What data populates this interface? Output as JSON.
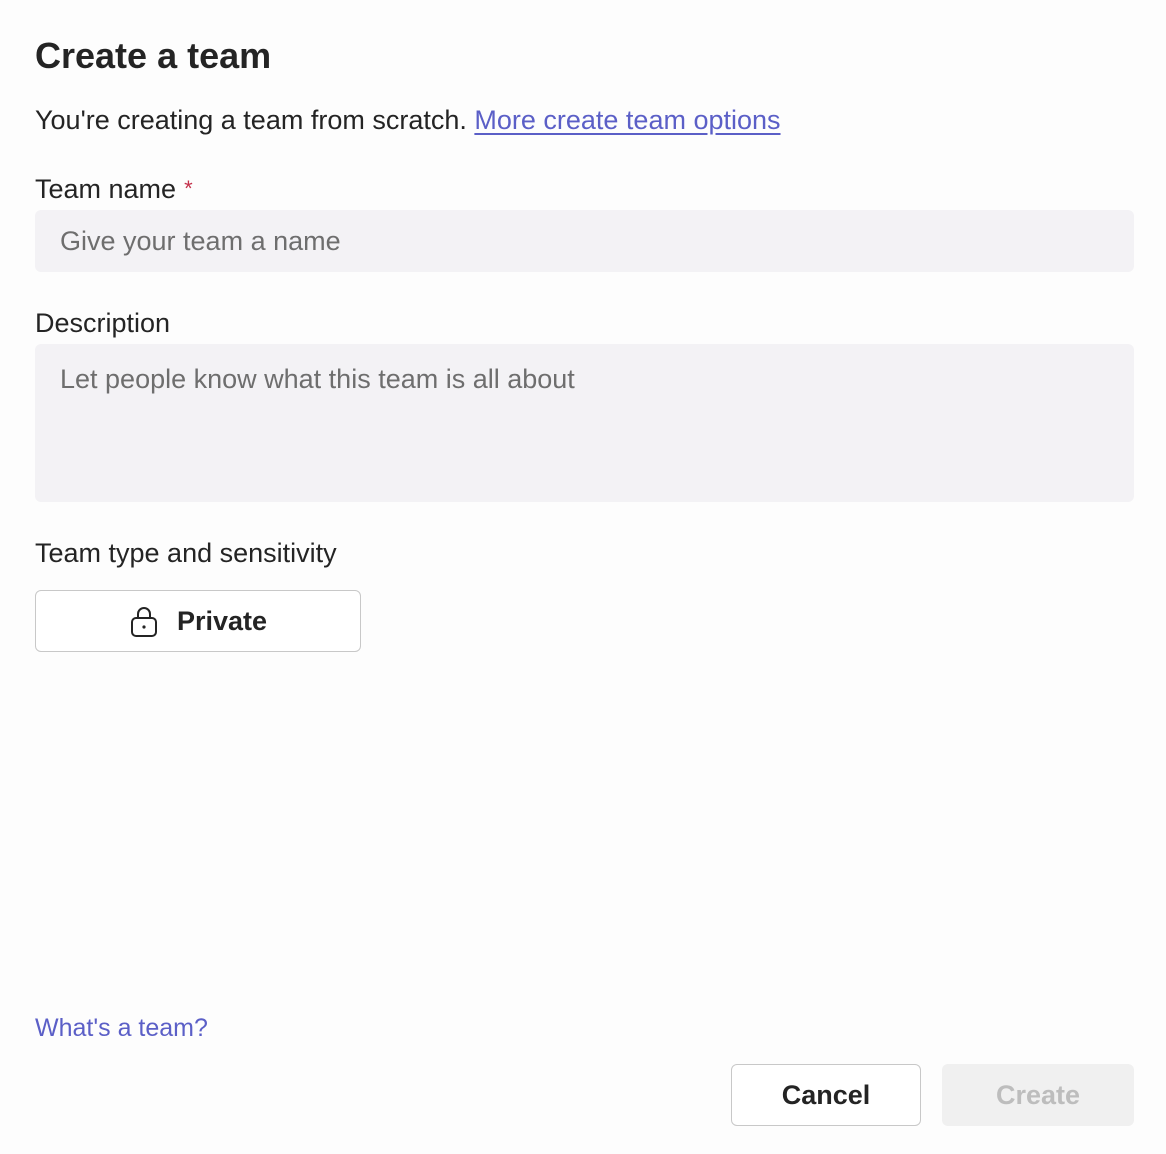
{
  "dialog": {
    "title": "Create a team",
    "subtitle": "You're creating a team from scratch.",
    "more_options_link": "More create team options"
  },
  "team_name": {
    "label": "Team name",
    "required_marker": "*",
    "placeholder": "Give your team a name",
    "value": ""
  },
  "description": {
    "label": "Description",
    "placeholder": "Let people know what this team is all about",
    "value": ""
  },
  "privacy": {
    "label": "Team type and sensitivity",
    "value": "Private",
    "icon": "lock-icon"
  },
  "footer": {
    "help_link": "What's a team?",
    "cancel_label": "Cancel",
    "create_label": "Create"
  },
  "colors": {
    "accent": "#5b5fc7",
    "required": "#c4314b",
    "input_bg": "#f3f2f5",
    "disabled_bg": "#f0f0f0",
    "disabled_text": "#bdbdbd"
  }
}
